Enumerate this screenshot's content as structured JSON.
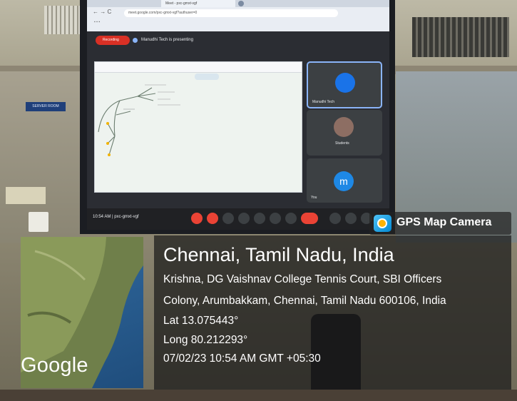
{
  "screen": {
    "browser_tab": "Meet - pxc-gmxt-vgf",
    "address": "meet.google.com/pxc-gmxt-vgf?authuser=0",
    "recording_label": "Recording",
    "presenting_text": "Manudhi Tech is presenting",
    "tiles": [
      {
        "name": "Manudhi Tech",
        "avatar_color": "#1a73e8"
      },
      {
        "name": "Students",
        "avatar_color": "#8d6e63"
      },
      {
        "name": "You",
        "avatar_letter": "m",
        "avatar_color": "#1e88e5"
      }
    ],
    "meeting_time": "10:54 AM | pxc-gmxt-vgf",
    "accent_red": "#ea4335"
  },
  "wall": {
    "door_sign": "SERVER ROOM"
  },
  "gps": {
    "app_name": "GPS Map Camera",
    "map_brand": "Google",
    "title": "Chennai, Tamil Nadu, India",
    "address_line_1": "Krishna, DG Vaishnav College Tennis Court, SBI Officers",
    "address_line_2": "Colony, Arumbakkam, Chennai, Tamil Nadu 600106, India",
    "lat": "Lat 13.075443°",
    "long": "Long 80.212293°",
    "datetime": "07/02/23 10:54 AM GMT +05:30",
    "app_icon": "gps-camera-icon"
  }
}
